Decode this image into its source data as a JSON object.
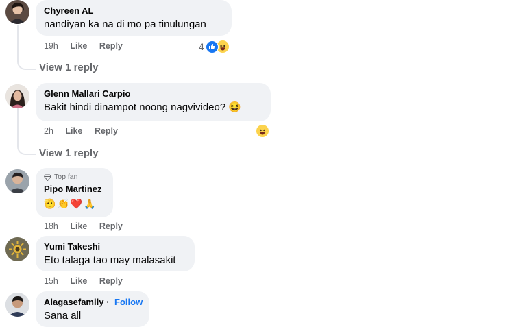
{
  "comments": [
    {
      "name": "Chyreen AL",
      "text": "nandiyan ka na di mo pa tinulungan",
      "time": "19h",
      "like": "Like",
      "reply": "Reply",
      "reaction_count": "4",
      "reactions": [
        "like-icon",
        "haha-icon"
      ],
      "view_replies": "View 1 reply"
    },
    {
      "name": "Glenn Mallari Carpio",
      "text": "Bakit hindi dinampot noong nagvivideo? 😆",
      "time": "2h",
      "like": "Like",
      "reply": "Reply",
      "reactions": [
        "haha-icon"
      ],
      "view_replies": "View 1 reply"
    },
    {
      "badge": "Top fan",
      "name": "Pipo Martinez",
      "emojis": [
        "🫡",
        "👏",
        "❤️",
        "🙏"
      ],
      "time": "18h",
      "like": "Like",
      "reply": "Reply"
    },
    {
      "name": "Yumi Takeshi",
      "text": "Eto talaga tao may malasakit",
      "time": "15h",
      "like": "Like",
      "reply": "Reply"
    },
    {
      "name": "Alagasefamily",
      "separator": "·",
      "follow": "Follow",
      "text": "Sana all"
    }
  ],
  "colors": {
    "bubble": "#f0f2f5",
    "meta": "#65676b",
    "like_blue": "#1877f2",
    "haha_yellow": "#fcd34d"
  }
}
